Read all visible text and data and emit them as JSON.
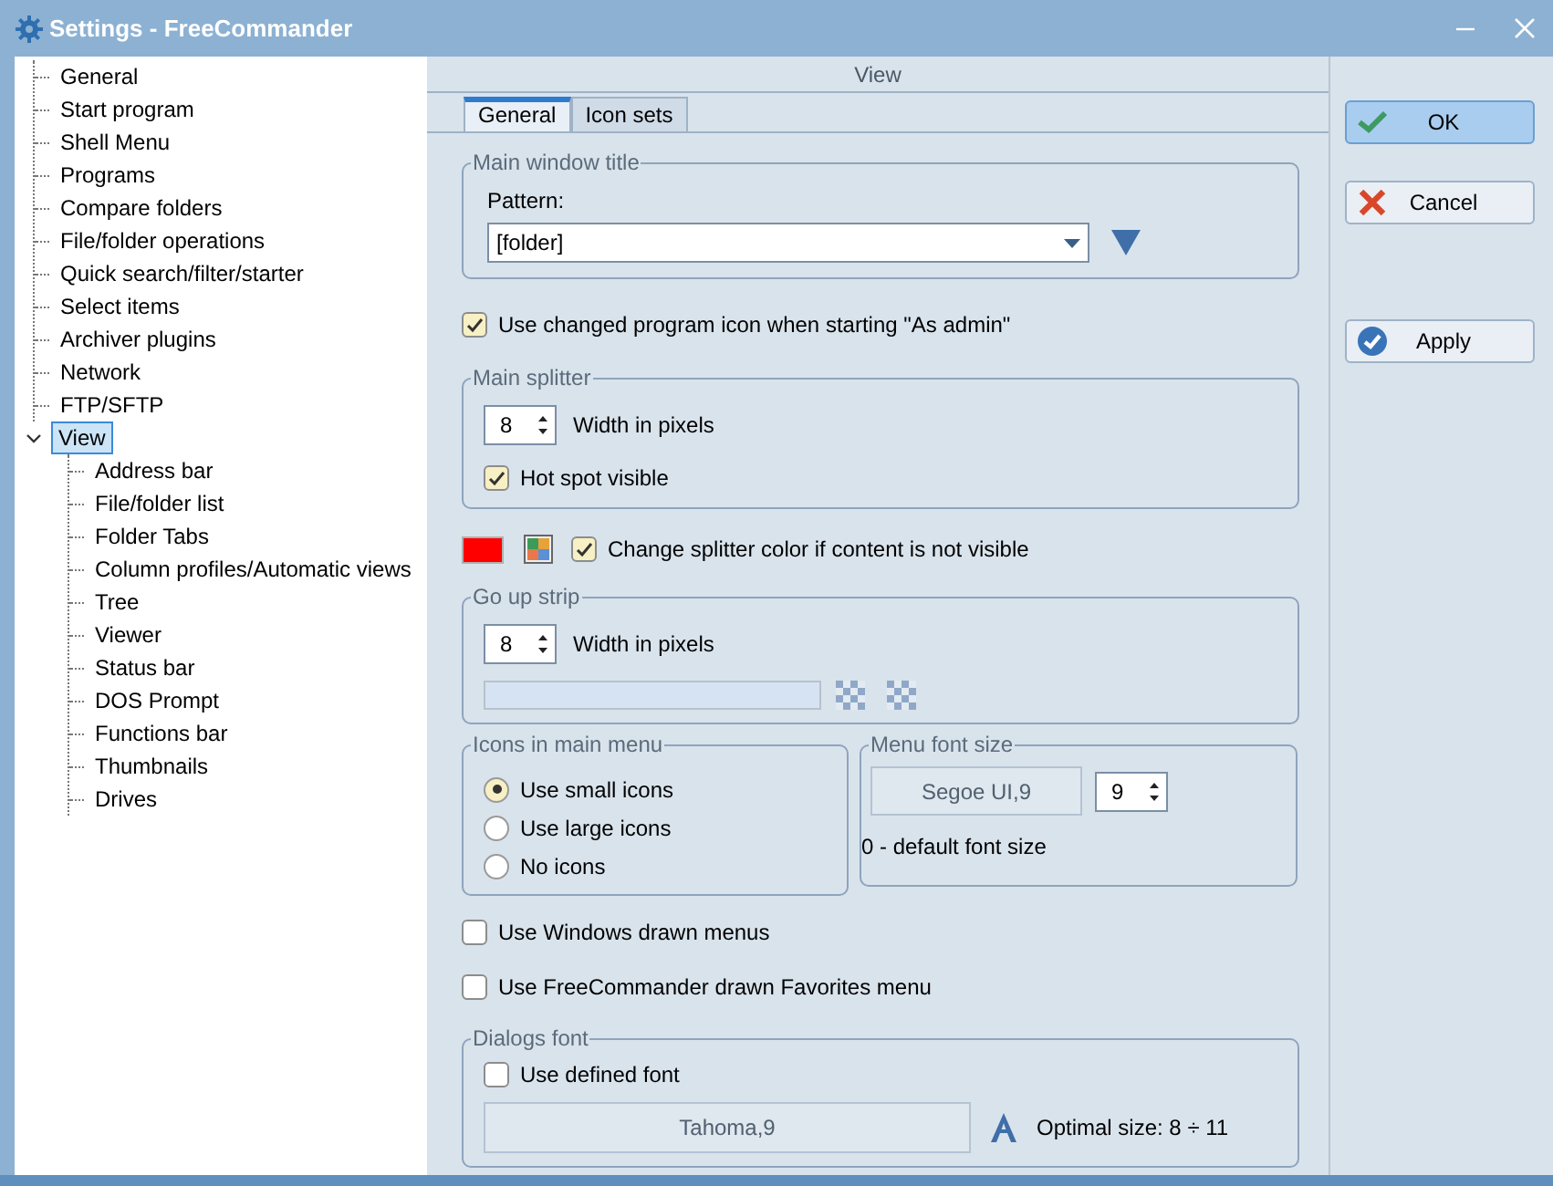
{
  "window": {
    "title": "Settings - FreeCommander"
  },
  "tree": [
    {
      "label": "General",
      "selected": false
    },
    {
      "label": "Start program",
      "selected": false
    },
    {
      "label": "Shell Menu",
      "selected": false
    },
    {
      "label": "Programs",
      "selected": false
    },
    {
      "label": "Compare folders",
      "selected": false
    },
    {
      "label": "File/folder operations",
      "selected": false
    },
    {
      "label": "Quick search/filter/starter",
      "selected": false
    },
    {
      "label": "Select items",
      "selected": false
    },
    {
      "label": "Archiver plugins",
      "selected": false
    },
    {
      "label": "Network",
      "selected": false
    },
    {
      "label": "FTP/SFTP",
      "selected": false
    },
    {
      "label": "View",
      "selected": true,
      "expanded": true,
      "children": [
        {
          "label": "Address bar",
          "selected": false
        },
        {
          "label": "File/folder list",
          "selected": false
        },
        {
          "label": "Folder Tabs",
          "selected": false
        },
        {
          "label": "Column profiles/Automatic views",
          "selected": false
        },
        {
          "label": "Tree",
          "selected": false
        },
        {
          "label": "Viewer",
          "selected": false
        },
        {
          "label": "Status bar",
          "selected": false
        },
        {
          "label": "DOS Prompt",
          "selected": false
        },
        {
          "label": "Functions bar",
          "selected": false
        },
        {
          "label": "Thumbnails",
          "selected": false
        },
        {
          "label": "Drives",
          "selected": false
        }
      ]
    }
  ],
  "panel": {
    "title": "View",
    "tabs": [
      {
        "label": "General",
        "selected": true
      },
      {
        "label": "Icon sets",
        "selected": false
      }
    ],
    "main_window_title": {
      "legend": "Main window title",
      "pattern_label": "Pattern:",
      "pattern_value": "[folder]"
    },
    "admin_icon": {
      "label": "Use changed program icon when starting \"As admin\"",
      "checked": true
    },
    "main_splitter": {
      "legend": "Main splitter",
      "width_value": "8",
      "width_label": "Width in pixels",
      "hot_spot": {
        "label": "Hot spot visible",
        "checked": true
      }
    },
    "splitter_color": {
      "color": "#ff0000",
      "label": "Change splitter color if content is not visible",
      "checked": true
    },
    "go_up_strip": {
      "legend": "Go up strip",
      "width_value": "8",
      "width_label": "Width in pixels"
    },
    "icons_in_main_menu": {
      "legend": "Icons in main menu",
      "options": [
        {
          "label": "Use small icons",
          "selected": true
        },
        {
          "label": "Use large icons",
          "selected": false
        },
        {
          "label": "No icons",
          "selected": false
        }
      ]
    },
    "menu_font_size": {
      "legend": "Menu font size",
      "font": "Segoe UI,9",
      "size_value": "9",
      "note": "0 - default font size"
    },
    "windows_menus": {
      "label": "Use Windows drawn menus",
      "checked": false
    },
    "favorites_menu": {
      "label": "Use FreeCommander drawn Favorites menu",
      "checked": false
    },
    "dialogs_font": {
      "legend": "Dialogs font",
      "use_defined": {
        "label": "Use defined font",
        "checked": false
      },
      "font": "Tahoma,9",
      "optimal": "Optimal size: 8 ÷ 11"
    }
  },
  "buttons": [
    {
      "label": "OK",
      "kind": "ok",
      "focused": true
    },
    {
      "label": "Cancel",
      "kind": "cancel",
      "focused": false
    },
    {
      "label": "Apply",
      "kind": "apply",
      "focused": false
    }
  ]
}
